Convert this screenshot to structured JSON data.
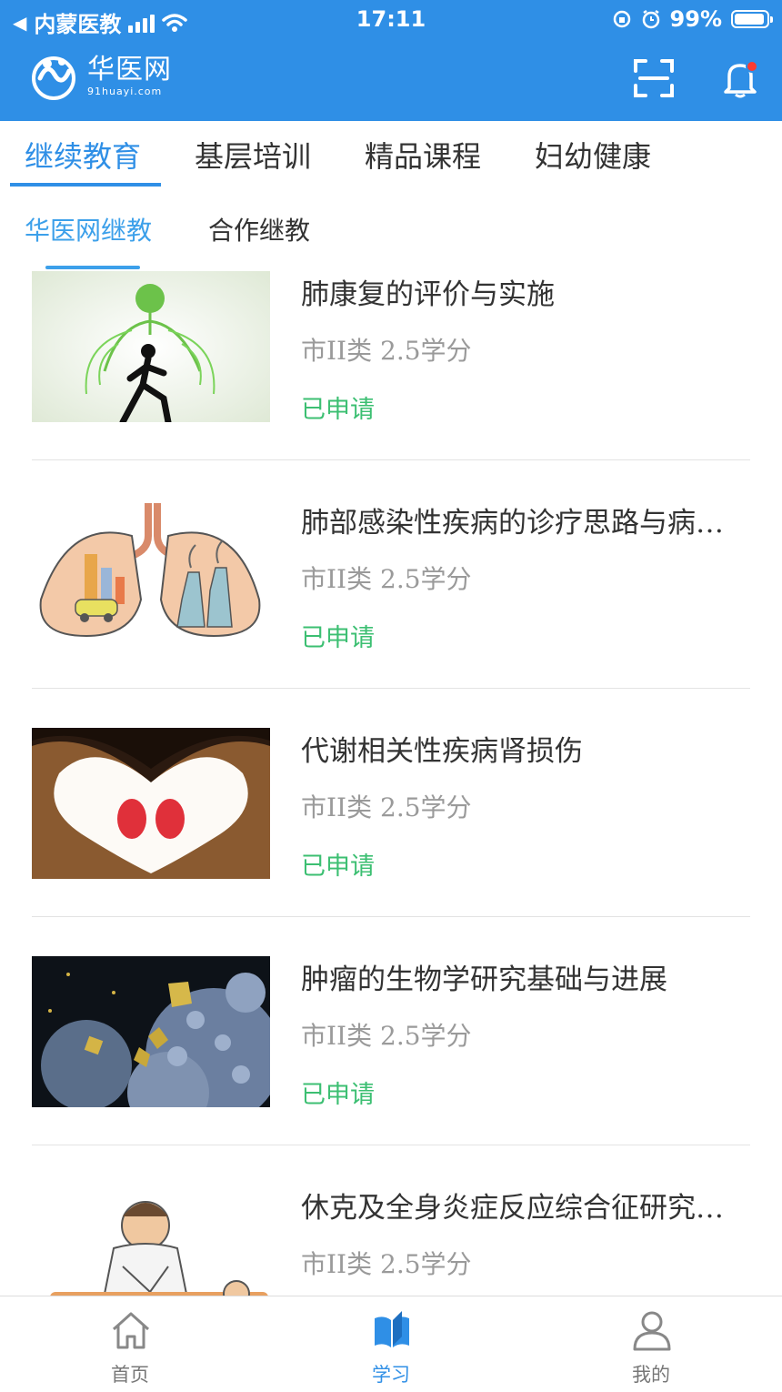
{
  "status_bar": {
    "back_app": "内蒙医教",
    "time": "17:11",
    "battery": "99%"
  },
  "header": {
    "brand_name": "华医网",
    "brand_domain": "91huayi.com"
  },
  "primary_tabs": [
    {
      "label": "继续教育",
      "active": true
    },
    {
      "label": "基层培训",
      "active": false
    },
    {
      "label": "精品课程",
      "active": false
    },
    {
      "label": "妇幼健康",
      "active": false
    }
  ],
  "secondary_tabs": [
    {
      "label": "华医网继教",
      "active": true
    },
    {
      "label": "合作继教",
      "active": false
    }
  ],
  "courses": [
    {
      "title": "肺康复的评价与实施",
      "meta": "市II类  2.5学分",
      "status": "已申请",
      "thumb": "lung-runner"
    },
    {
      "title": "肺部感染性疾病的诊疗思路与病…",
      "meta": "市II类  2.5学分",
      "status": "已申请",
      "thumb": "lung-pollution"
    },
    {
      "title": "代谢相关性疾病肾损伤",
      "meta": "市II类  2.5学分",
      "status": "已申请",
      "thumb": "heart-hands-kidney"
    },
    {
      "title": "肿瘤的生物学研究基础与进展",
      "meta": "市II类  2.5学分",
      "status": "已申请",
      "thumb": "tumor-cells"
    },
    {
      "title": "休克及全身炎症反应综合征研究…",
      "meta": "市II类  2.5学分",
      "status": "",
      "thumb": "cpr"
    }
  ],
  "bottom_nav": [
    {
      "label": "首页",
      "icon": "home-icon",
      "active": false
    },
    {
      "label": "学习",
      "icon": "book-icon",
      "active": true
    },
    {
      "label": "我的",
      "icon": "user-icon",
      "active": false
    }
  ],
  "colors": {
    "primary": "#2f8fe6",
    "status_green": "#3cbf72",
    "meta_gray": "#9a9a9a"
  }
}
